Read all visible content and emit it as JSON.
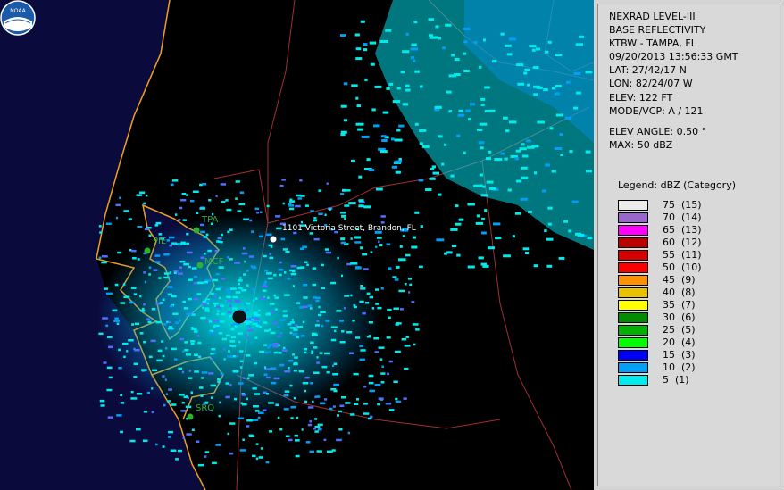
{
  "info": {
    "product": "NEXRAD LEVEL-III",
    "type": "BASE REFLECTIVITY",
    "station": "KTBW - TAMPA, FL",
    "datetime": "09/20/2013 13:56:33 GMT",
    "lat": "LAT: 27/42/17 N",
    "lon": "LON: 82/24/07 W",
    "elev": "ELEV: 122 FT",
    "mode": "MODE/VCP: A / 121",
    "elev_angle": "ELEV ANGLE: 0.50 °",
    "max": "MAX: 50 dBZ"
  },
  "legend": {
    "title": "Legend: dBZ (Category)",
    "entries": [
      {
        "text": "75  (15)",
        "color": "#ebebeb"
      },
      {
        "text": "70  (14)",
        "color": "#9966cc"
      },
      {
        "text": "65  (13)",
        "color": "#ff00ff"
      },
      {
        "text": "60  (12)",
        "color": "#bc0000"
      },
      {
        "text": "55  (11)",
        "color": "#d40000"
      },
      {
        "text": "50  (10)",
        "color": "#ff0000"
      },
      {
        "text": "45  (9)",
        "color": "#ff9000"
      },
      {
        "text": "40  (8)",
        "color": "#e7c000"
      },
      {
        "text": "35  (7)",
        "color": "#ffff00"
      },
      {
        "text": "30  (6)",
        "color": "#008e00"
      },
      {
        "text": "25  (5)",
        "color": "#01b101"
      },
      {
        "text": "20  (4)",
        "color": "#02fd02"
      },
      {
        "text": "15  (3)",
        "color": "#0000f6"
      },
      {
        "text": "10  (2)",
        "color": "#01a0f6"
      },
      {
        "text": "5  (1)",
        "color": "#00ecec"
      }
    ]
  },
  "sites": [
    {
      "code": "TPA"
    },
    {
      "code": "PIE"
    },
    {
      "code": "MCF"
    },
    {
      "code": "SRQ"
    }
  ],
  "marker_label": "1101 Victoria Street, Brandon, FL",
  "logo_text": "NOAA"
}
